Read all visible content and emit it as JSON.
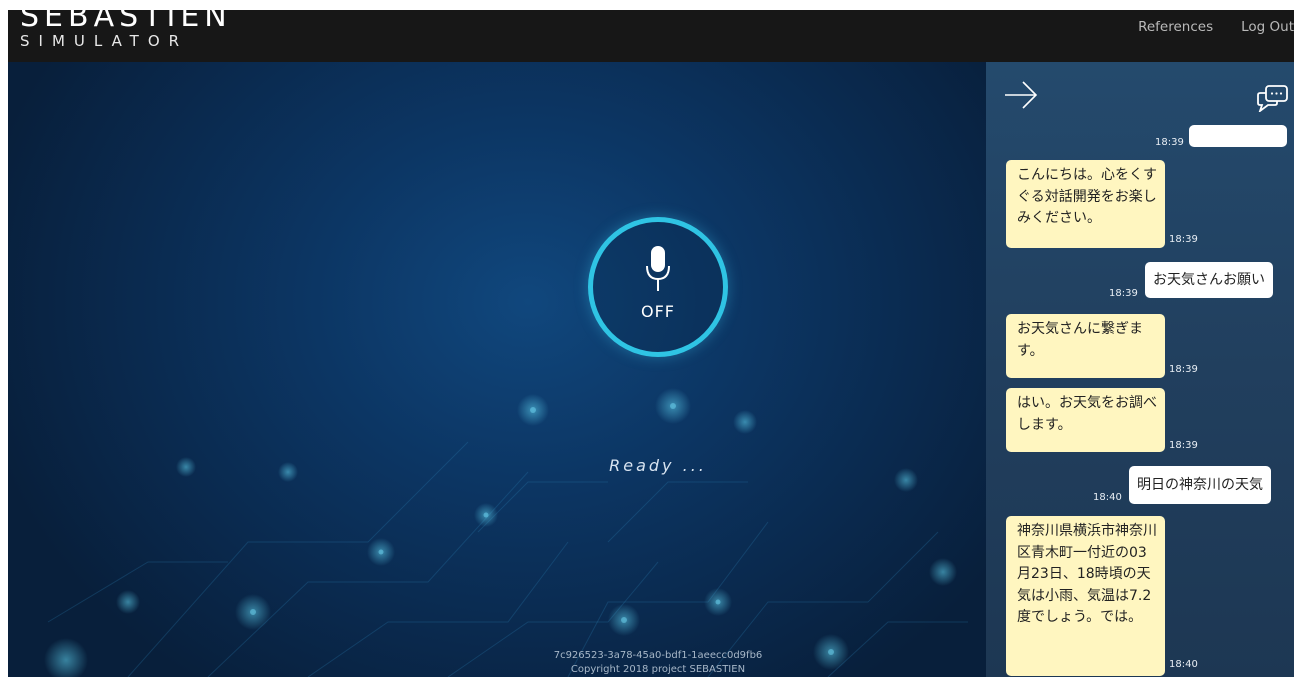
{
  "header": {
    "logo_title": "SEBASTIEN",
    "logo_subtitle": "SIMULATOR",
    "nav": [
      {
        "label": "References"
      },
      {
        "label": "Log Out"
      }
    ]
  },
  "stage": {
    "mic_state": "OFF",
    "status": "Ready ...",
    "session_id": "7c926523-3a78-45a0-bdf1-1aeecc0d9fb6",
    "copyright": "Copyright 2018 project SEBASTIEN"
  },
  "chat": {
    "messages": [
      {
        "sender": "user",
        "text": "",
        "time": "18:39"
      },
      {
        "sender": "bot",
        "text": "こんにちは。心をくすぐる対話開発をお楽しみください。",
        "time": "18:39"
      },
      {
        "sender": "user",
        "text": "お天気さんお願い",
        "time": "18:39"
      },
      {
        "sender": "bot",
        "text": "お天気さんに繋ぎます。",
        "time": "18:39"
      },
      {
        "sender": "bot",
        "text": "はい。お天気をお調べします。",
        "time": "18:39"
      },
      {
        "sender": "user",
        "text": "明日の神奈川の天気",
        "time": "18:40"
      },
      {
        "sender": "bot",
        "text": "神奈川県横浜市神奈川区青木町一付近の03月23日、18時頃の天気は小雨、気温は7.2度でしょう。では。",
        "time": "18:40"
      }
    ]
  },
  "colors": {
    "header_bg": "#171717",
    "stage_bg": "#0c3664",
    "accent_ring": "#2fc4e4",
    "chat_panel_bg": "#233f5e",
    "bot_bubble": "#fff6c0",
    "user_bubble": "#ffffff"
  },
  "icons": {
    "mic": "microphone-icon",
    "collapse": "arrow-right-icon",
    "chat_log": "chat-bubble-icon"
  }
}
